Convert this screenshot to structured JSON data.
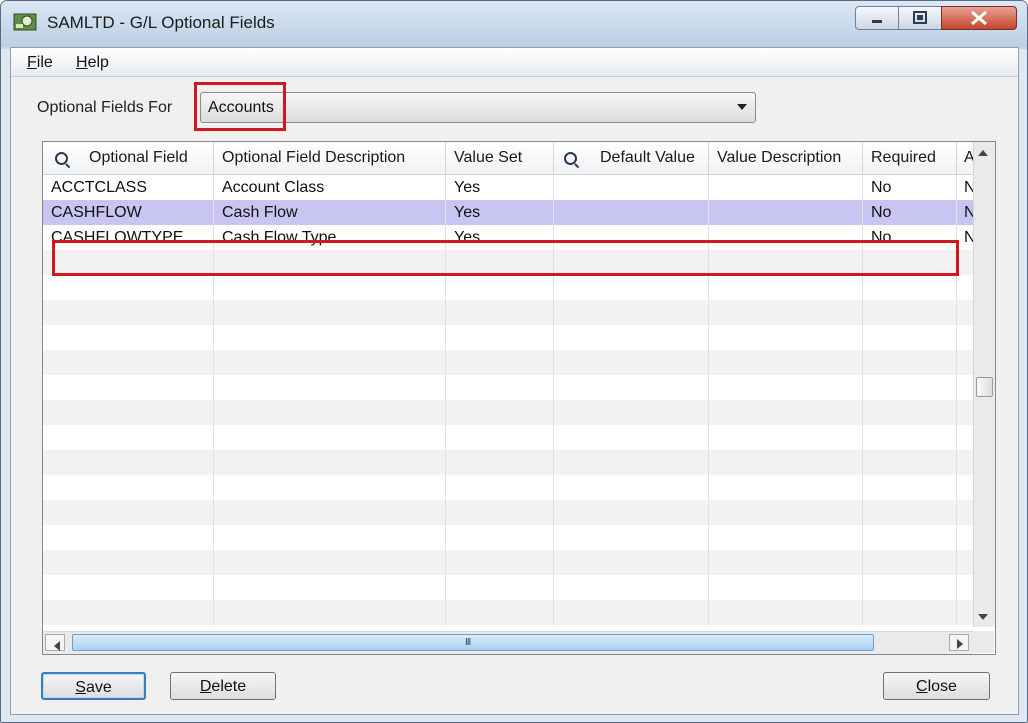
{
  "window": {
    "title": "SAMLTD - G/L Optional Fields"
  },
  "menu": {
    "file": {
      "accel": "F",
      "rest": "ile"
    },
    "help": {
      "accel": "H",
      "rest": "elp"
    }
  },
  "optional_fields_for": {
    "label": "Optional Fields For",
    "value": "Accounts"
  },
  "grid": {
    "columns": [
      "Optional Field",
      "Optional Field Description",
      "Value Set",
      "Default Value",
      "Value Description",
      "Required",
      "A"
    ],
    "rows": [
      [
        "ACCTCLASS",
        "Account Class",
        "Yes",
        "",
        "",
        "No",
        "N"
      ],
      [
        "CASHFLOW",
        "Cash Flow",
        "Yes",
        "",
        "",
        "No",
        "N"
      ],
      [
        "CASHFLOWTYPE",
        "Cash Flow Type",
        "Yes",
        "",
        "",
        "No",
        "N"
      ]
    ],
    "selected_row_index": 1,
    "hscroll_grip": "III"
  },
  "buttons": {
    "save": {
      "accel": "S",
      "rest": "ave"
    },
    "delete": {
      "accel": "D",
      "rest": "elete"
    },
    "close": {
      "accel": "C",
      "rest": "lose"
    }
  },
  "colors": {
    "highlight_box": "#d01820",
    "selected_row": "#c8c5f3",
    "stripe": "#f2f2f2"
  },
  "icons": [
    "app-icon",
    "minimize-icon",
    "maximize-icon",
    "close-icon",
    "search-icon",
    "dropdown-arrow-icon"
  ]
}
